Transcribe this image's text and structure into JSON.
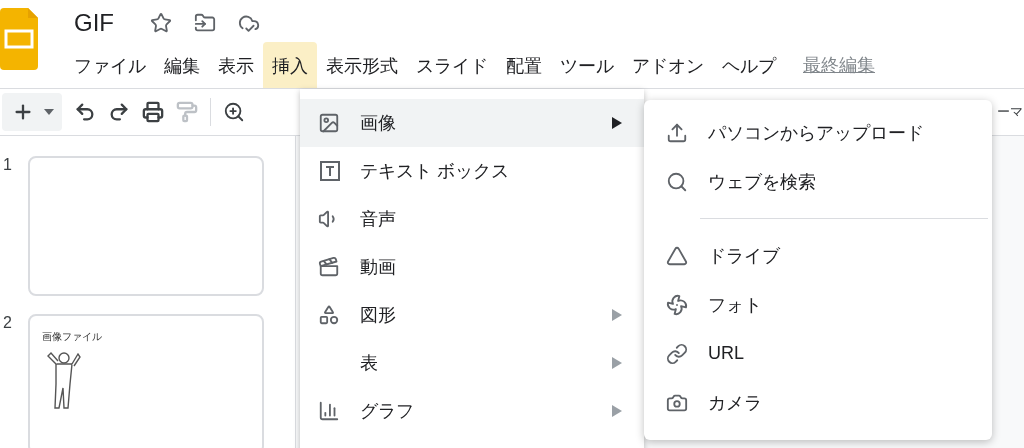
{
  "document": {
    "title": "GIF"
  },
  "menus": [
    {
      "label": "ファイル",
      "selected": false
    },
    {
      "label": "編集",
      "selected": false
    },
    {
      "label": "表示",
      "selected": false
    },
    {
      "label": "挿入",
      "selected": true
    },
    {
      "label": "表示形式",
      "selected": false
    },
    {
      "label": "スライド",
      "selected": false
    },
    {
      "label": "配置",
      "selected": false
    },
    {
      "label": "ツール",
      "selected": false
    },
    {
      "label": "アドオン",
      "selected": false
    },
    {
      "label": "ヘルプ",
      "selected": false
    }
  ],
  "last_edit_link": "最終編集",
  "toolbar": {
    "cut_label": "ーマ"
  },
  "slides": [
    {
      "number": "1",
      "kind": "blank"
    },
    {
      "number": "2",
      "kind": "figure",
      "text": "画像ファイル"
    }
  ],
  "insert_menu": [
    {
      "label": "画像",
      "kind": "image",
      "has_submenu": true,
      "selected": true
    },
    {
      "label": "テキスト ボックス",
      "kind": "textbox",
      "has_submenu": false,
      "selected": false
    },
    {
      "label": "音声",
      "kind": "audio",
      "has_submenu": false,
      "selected": false
    },
    {
      "label": "動画",
      "kind": "video",
      "has_submenu": false,
      "selected": false
    },
    {
      "label": "図形",
      "kind": "shape",
      "has_submenu": true,
      "selected": false
    },
    {
      "label": "表",
      "kind": "table",
      "has_submenu": true,
      "selected": false
    },
    {
      "label": "グラフ",
      "kind": "chart",
      "has_submenu": true,
      "selected": false
    }
  ],
  "image_submenu": [
    {
      "label": "パソコンからアップロード",
      "kind": "upload"
    },
    {
      "label": "ウェブを検索",
      "kind": "search"
    },
    {
      "kind": "separator"
    },
    {
      "label": "ドライブ",
      "kind": "drive"
    },
    {
      "label": "フォト",
      "kind": "photos"
    },
    {
      "label": "URL",
      "kind": "url"
    },
    {
      "label": "カメラ",
      "kind": "camera"
    }
  ]
}
